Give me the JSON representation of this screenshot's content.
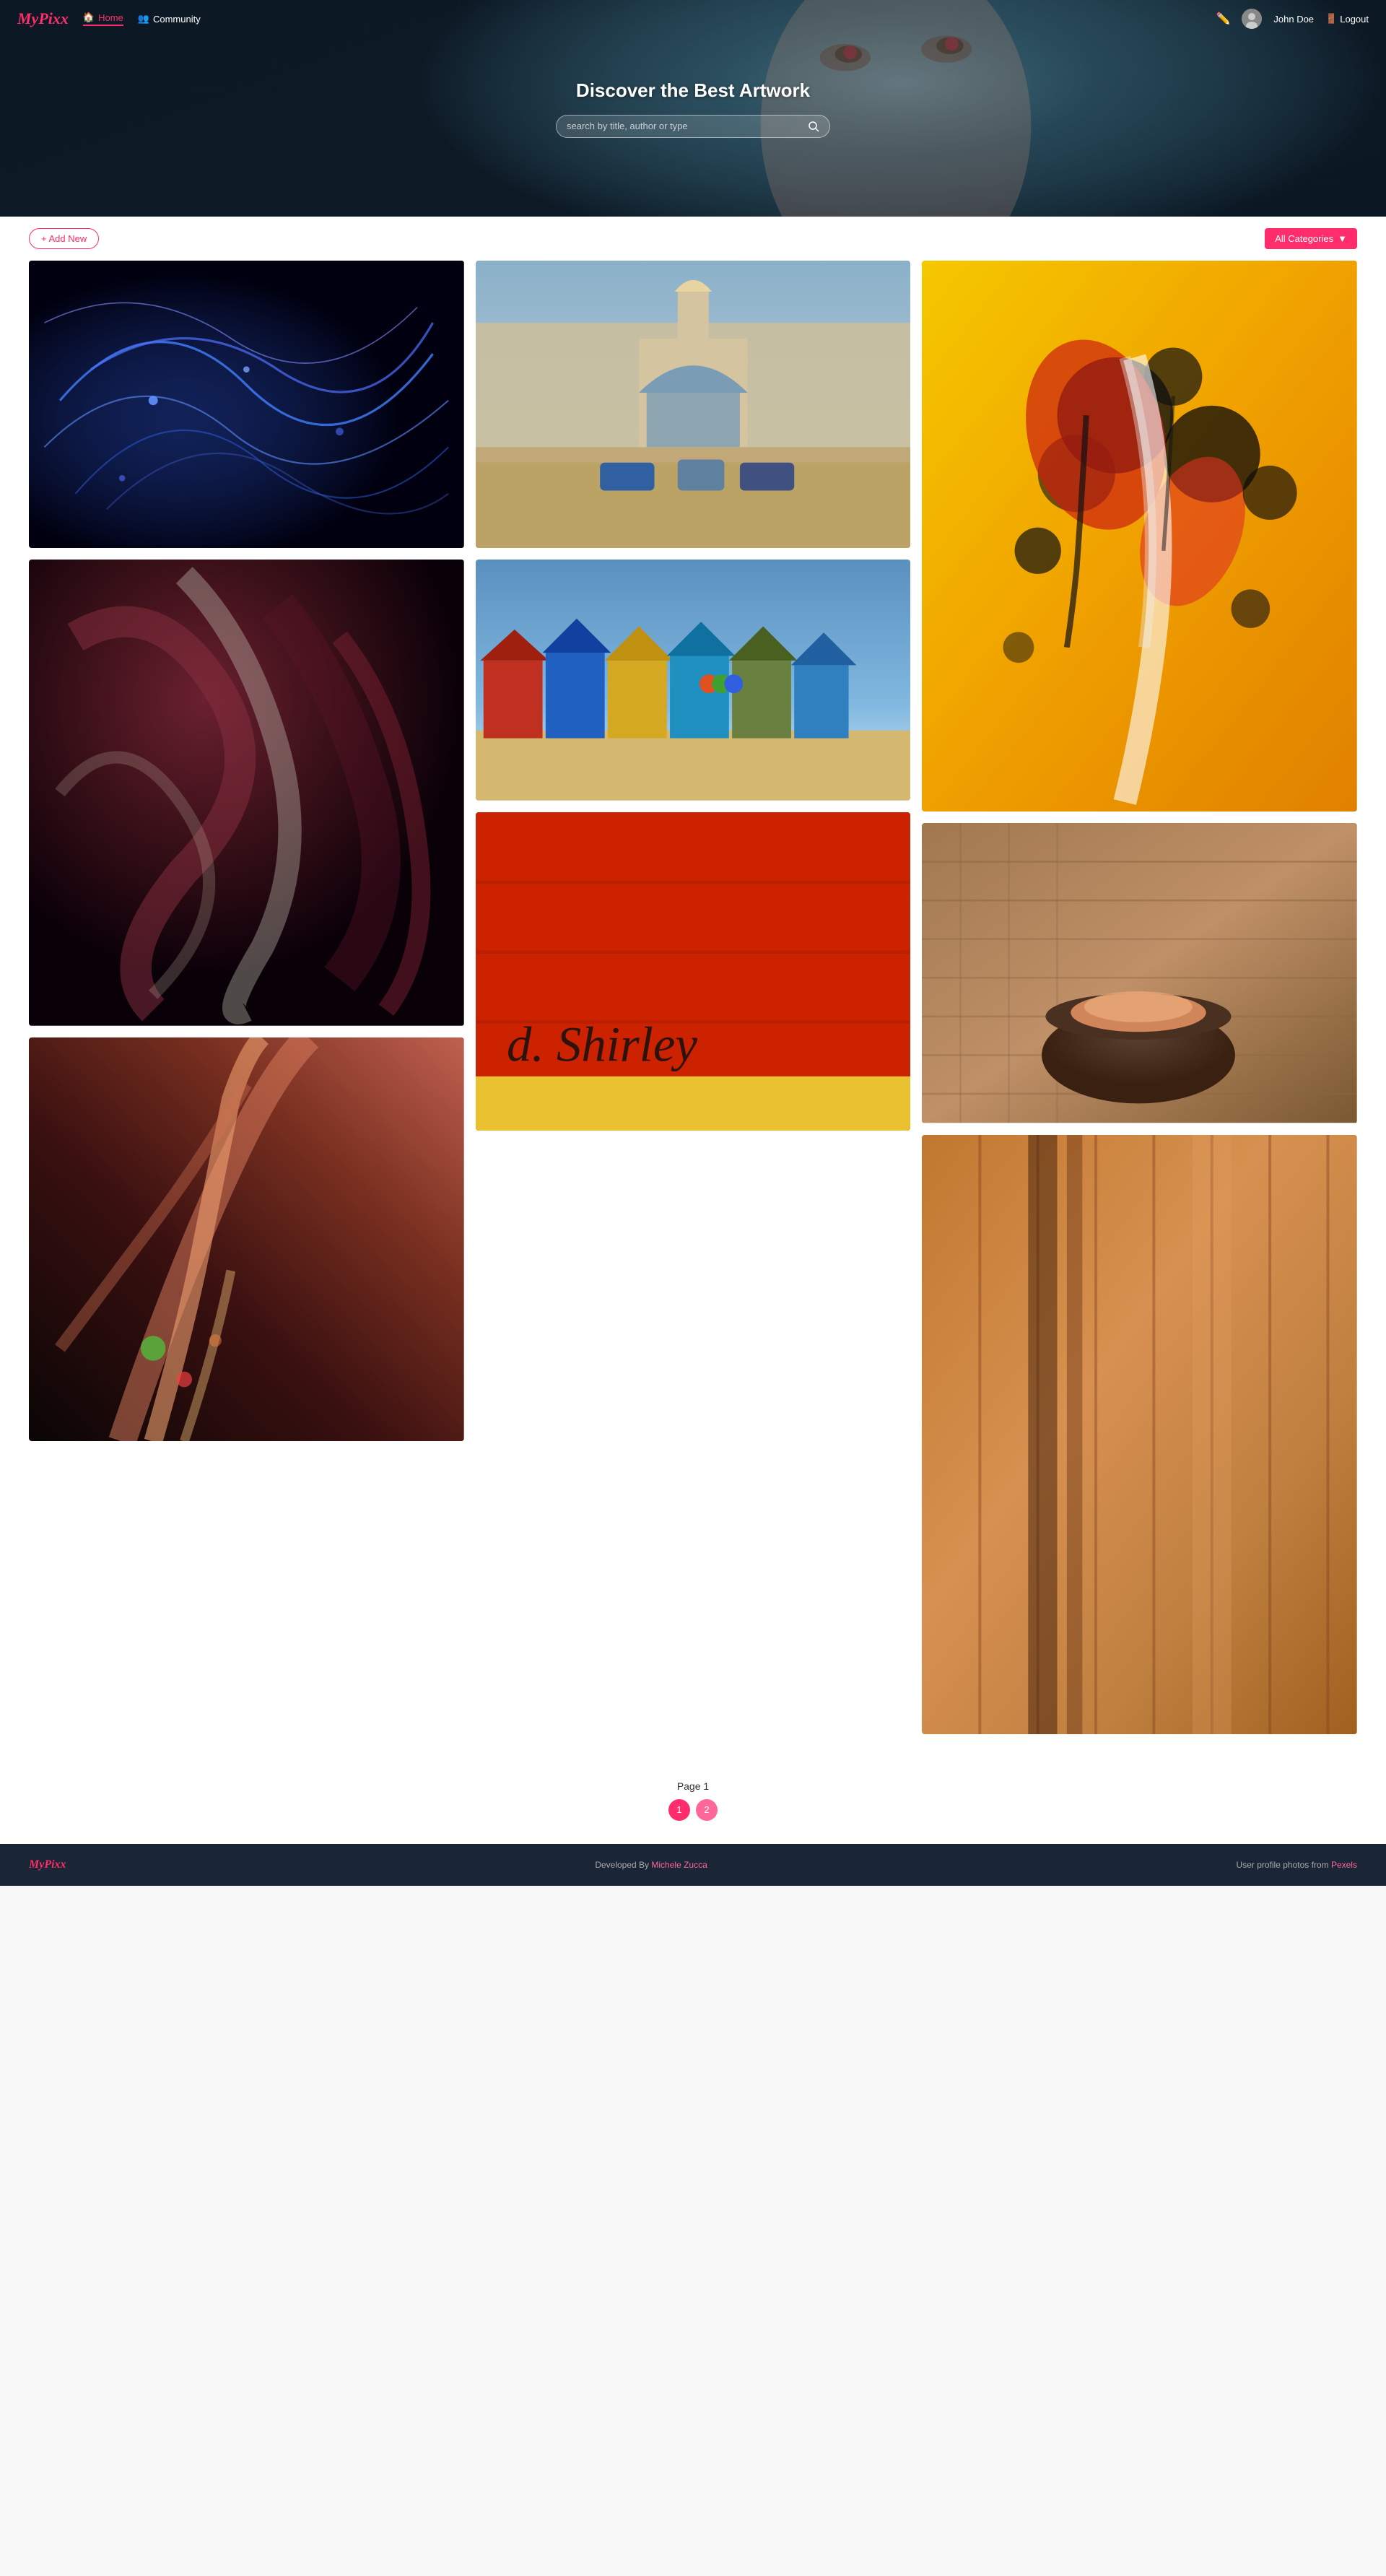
{
  "app": {
    "name": "MyPixx",
    "logo": "MyPixx"
  },
  "nav": {
    "home_label": "Home",
    "community_label": "Community",
    "username": "John Doe",
    "logout_label": "Logout"
  },
  "hero": {
    "title": "Discover the Best Artwork",
    "search_placeholder": "search by title, author or type"
  },
  "toolbar": {
    "add_new_label": "+ Add New",
    "categories_label": "All Categories"
  },
  "gallery": {
    "columns": 3,
    "items": [
      {
        "id": 1,
        "col": 1,
        "type": "digital",
        "colors": [
          "#0a0a2e",
          "#0d2060",
          "#000010"
        ]
      },
      {
        "id": 2,
        "col": 2,
        "type": "photo",
        "colors": [
          "#7a9db5",
          "#c8b090",
          "#b89870"
        ]
      },
      {
        "id": 3,
        "col": 3,
        "type": "painting",
        "colors": [
          "#f5c800",
          "#e08000",
          "#c06000"
        ]
      },
      {
        "id": 4,
        "col": 1,
        "type": "painting",
        "colors": [
          "#3a1520",
          "#6a2030",
          "#1a0a10"
        ]
      },
      {
        "id": 5,
        "col": 2,
        "type": "photo",
        "colors": [
          "#4a90c0",
          "#e8c050",
          "#c07030"
        ]
      },
      {
        "id": 6,
        "col": 3,
        "type": "photo",
        "colors": [
          "#8a6040",
          "#c08060",
          "#5a3010"
        ]
      },
      {
        "id": 7,
        "col": 1,
        "type": "painting",
        "colors": [
          "#1a0a0a",
          "#6a2020",
          "#e07050"
        ]
      },
      {
        "id": 8,
        "col": 2,
        "type": "graffiti",
        "colors": [
          "#cc2200",
          "#ee4400",
          "#ffcc00"
        ]
      },
      {
        "id": 9,
        "col": 3,
        "type": "photo",
        "colors": [
          "#c08040",
          "#e0a060",
          "#a06020"
        ]
      }
    ]
  },
  "pagination": {
    "page_label": "Page 1",
    "pages": [
      "1",
      "2"
    ]
  },
  "footer": {
    "logo": "MyPixx",
    "developed_by": "Developed By",
    "developer_name": "Michele Zucca",
    "photos_by": "User profile photos from",
    "photos_source": "Pexels"
  }
}
